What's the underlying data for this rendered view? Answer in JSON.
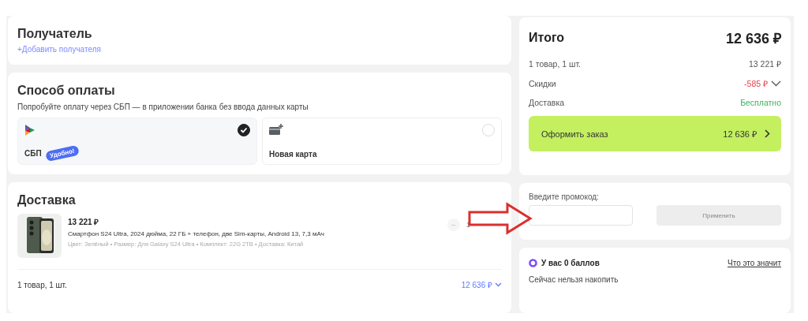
{
  "recipient": {
    "title": "Получатель",
    "add_link": "+Добавить получателя"
  },
  "payment": {
    "title": "Способ оплаты",
    "hint": "Попробуйте оплату через СБП — в приложении банка без ввода данных карты",
    "options": [
      {
        "kind": "sbp",
        "label": "СБП",
        "badge": "Удобно!",
        "selected": true
      },
      {
        "kind": "card",
        "label": "Новая карта",
        "selected": false
      }
    ]
  },
  "delivery": {
    "title": "Доставка",
    "item": {
      "kind": "picture",
      "price": "13 221 ₽",
      "name": "Смартфон S24 Ultra, 2024 дюйма, 22 ГБ + телефон, две Sim-карты, Android 13, 7,3 мАч",
      "attributes": "Цвет: Зелёный • Размер: Для Galaxy S24 Ultra • Комплект: 22G 2TB • Доставка: Китай",
      "minus": "−",
      "quantity": "1"
    },
    "footer_count": "1 товар, 1 шт.",
    "footer_total": "12 636 ₽"
  },
  "summary": {
    "title": "Итого",
    "total": "12 636 ₽",
    "rows": [
      {
        "kind": "plain",
        "label": "1 товар, 1 шт.",
        "value": "13 221 ₽"
      },
      {
        "kind": "discount",
        "label": "Скидки",
        "value": "-585 ₽"
      },
      {
        "kind": "free",
        "label": "Доставка",
        "value": "Бесплатно"
      }
    ],
    "checkout_label": "Оформить заказ",
    "checkout_total": "12 636 ₽"
  },
  "promo": {
    "label": "Введите промокод:",
    "apply": "Применить",
    "apply_disabled": true
  },
  "points": {
    "title": "У вас 0 баллов",
    "link": "Что это значит",
    "note": "Сейчас нельзя накопить"
  }
}
